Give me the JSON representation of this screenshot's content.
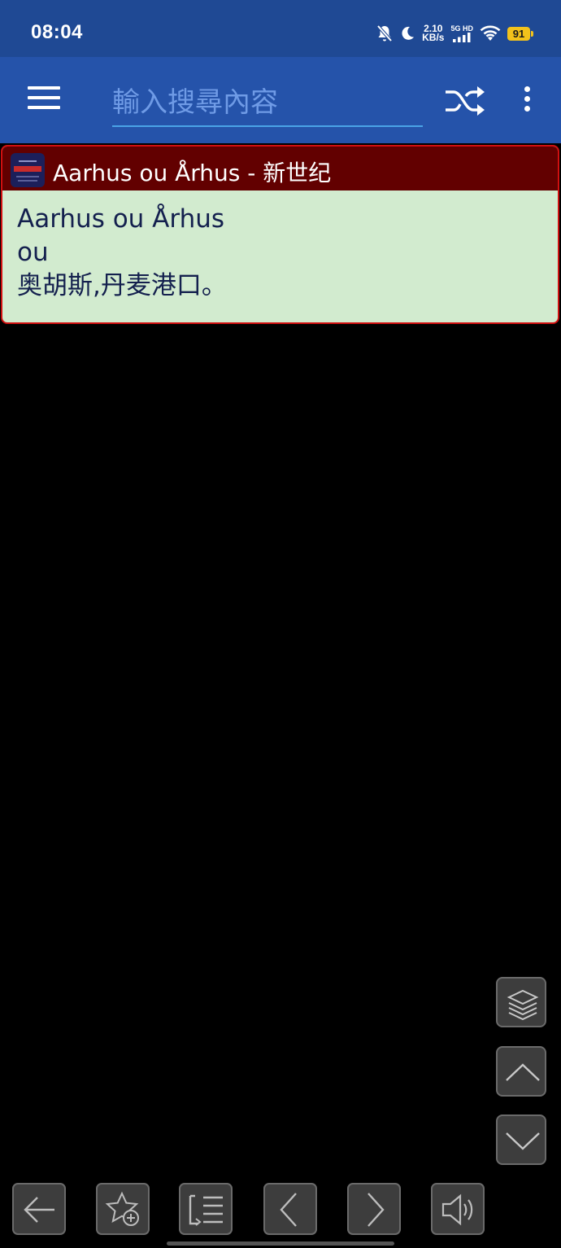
{
  "status_bar": {
    "time": "08:04",
    "net_speed_value": "2.10",
    "net_speed_unit": "KB/s",
    "signal_label": "5G HD",
    "battery": "91",
    "icons": [
      "mute-bell-icon",
      "moon-icon",
      "signal-bars-icon",
      "wifi-icon",
      "battery-icon"
    ]
  },
  "toolbar": {
    "search_placeholder": "輸入搜尋內容",
    "search_value": "",
    "icons": [
      "menu-icon",
      "shuffle-icon",
      "more-vert-icon"
    ]
  },
  "result": {
    "title": "Aarhus ou Århus - 新世纪",
    "lines": [
      "Aarhus ou Århus",
      "ou",
      "奥胡斯,丹麦港口。"
    ]
  },
  "side_buttons": [
    "layers-icon",
    "chevron-up-icon",
    "chevron-down-icon"
  ],
  "bottom_bar": [
    "arrow-left-icon",
    "star-add-icon",
    "list-icon",
    "chevron-left-icon",
    "chevron-right-icon",
    "speaker-icon"
  ],
  "colors": {
    "status_bar": "#1f4994",
    "toolbar": "#2553aa",
    "card_header": "#620000",
    "card_border": "#d01010",
    "card_body": "#d2ebcf",
    "battery": "#f2c21b"
  }
}
